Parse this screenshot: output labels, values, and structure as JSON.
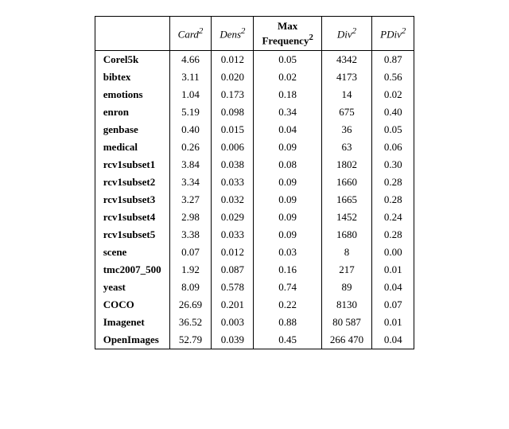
{
  "table": {
    "headers": [
      {
        "label": "Card²",
        "italic": true,
        "bold": false,
        "multirow": false
      },
      {
        "label": "Dens²",
        "italic": true,
        "bold": false,
        "multirow": false
      },
      {
        "label": "Max\nFrequency²",
        "italic": false,
        "bold": true,
        "superscript": "2",
        "multirow": true
      },
      {
        "label": "Div²",
        "italic": true,
        "bold": false,
        "multirow": false
      },
      {
        "label": "PDiv²",
        "italic": true,
        "bold": false,
        "multirow": false
      }
    ],
    "rows": [
      {
        "name": "Corel5k",
        "values": [
          "4.66",
          "0.012",
          "0.05",
          "4342",
          "0.87"
        ]
      },
      {
        "name": "bibtex",
        "values": [
          "3.11",
          "0.020",
          "0.02",
          "4173",
          "0.56"
        ]
      },
      {
        "name": "emotions",
        "values": [
          "1.04",
          "0.173",
          "0.18",
          "14",
          "0.02"
        ]
      },
      {
        "name": "enron",
        "values": [
          "5.19",
          "0.098",
          "0.34",
          "675",
          "0.40"
        ]
      },
      {
        "name": "genbase",
        "values": [
          "0.40",
          "0.015",
          "0.04",
          "36",
          "0.05"
        ]
      },
      {
        "name": "medical",
        "values": [
          "0.26",
          "0.006",
          "0.09",
          "63",
          "0.06"
        ]
      },
      {
        "name": "rcv1subset1",
        "values": [
          "3.84",
          "0.038",
          "0.08",
          "1802",
          "0.30"
        ]
      },
      {
        "name": "rcv1subset2",
        "values": [
          "3.34",
          "0.033",
          "0.09",
          "1660",
          "0.28"
        ]
      },
      {
        "name": "rcv1subset3",
        "values": [
          "3.27",
          "0.032",
          "0.09",
          "1665",
          "0.28"
        ]
      },
      {
        "name": "rcv1subset4",
        "values": [
          "2.98",
          "0.029",
          "0.09",
          "1452",
          "0.24"
        ]
      },
      {
        "name": "rcv1subset5",
        "values": [
          "3.38",
          "0.033",
          "0.09",
          "1680",
          "0.28"
        ]
      },
      {
        "name": "scene",
        "values": [
          "0.07",
          "0.012",
          "0.03",
          "8",
          "0.00"
        ]
      },
      {
        "name": "tmc2007_500",
        "values": [
          "1.92",
          "0.087",
          "0.16",
          "217",
          "0.01"
        ]
      },
      {
        "name": "yeast",
        "values": [
          "8.09",
          "0.578",
          "0.74",
          "89",
          "0.04"
        ]
      },
      {
        "name": "COCO",
        "values": [
          "26.69",
          "0.201",
          "0.22",
          "8130",
          "0.07"
        ]
      },
      {
        "name": "Imagenet",
        "values": [
          "36.52",
          "0.003",
          "0.88",
          "80 587",
          "0.01"
        ]
      },
      {
        "name": "OpenImages",
        "values": [
          "52.79",
          "0.039",
          "0.45",
          "266 470",
          "0.04"
        ]
      }
    ]
  }
}
